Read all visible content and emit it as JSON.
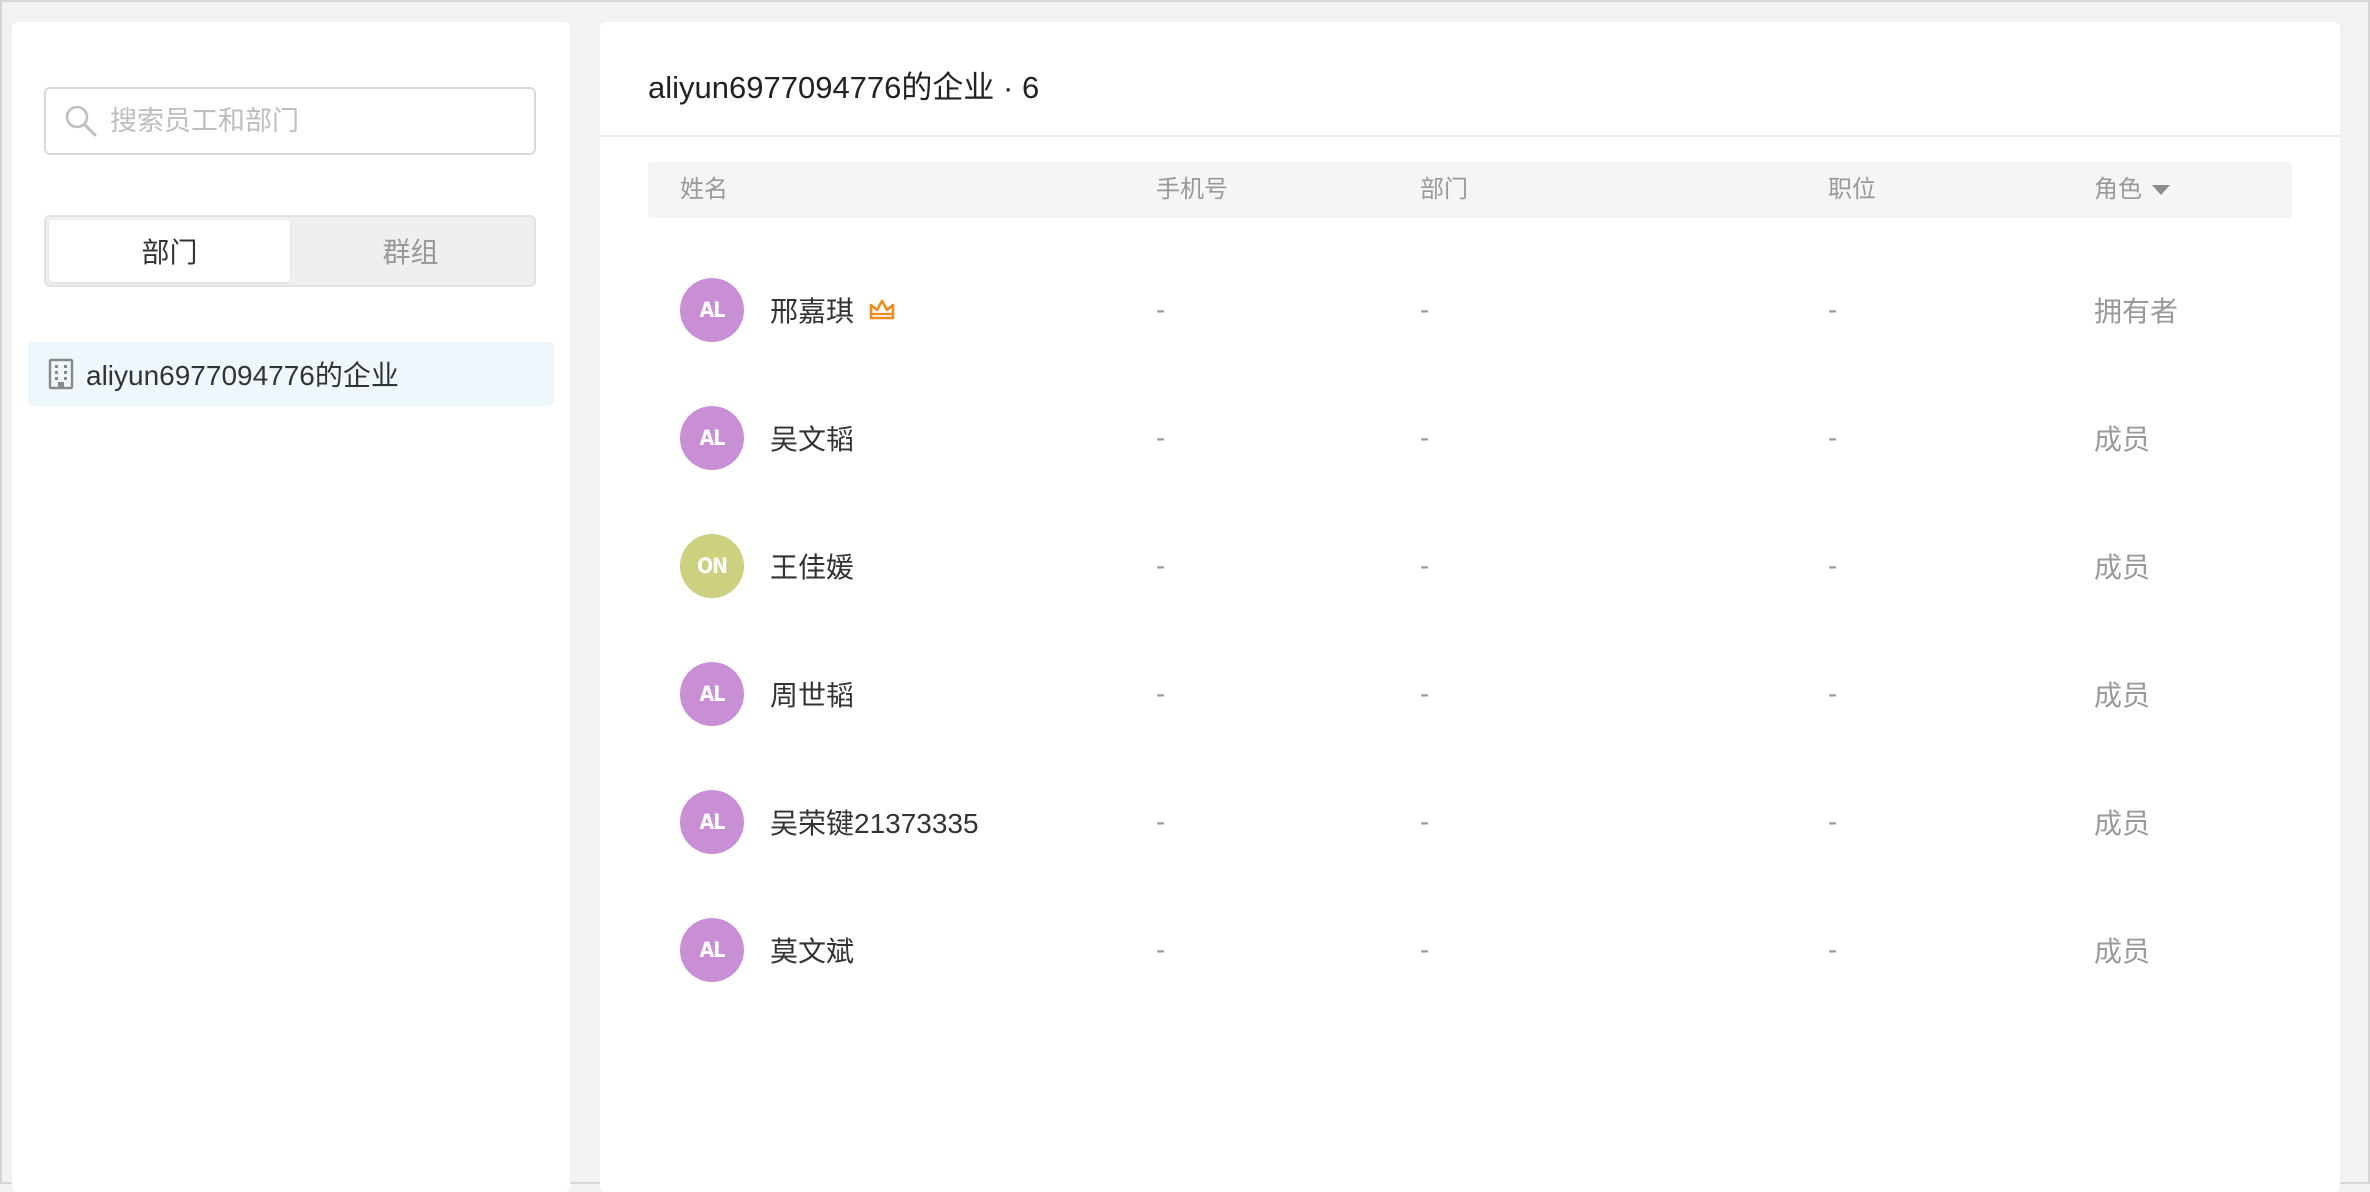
{
  "sidebar": {
    "search_placeholder": "搜索员工和部门",
    "tabs": [
      {
        "label": "部门",
        "active": true
      },
      {
        "label": "群组",
        "active": false
      }
    ],
    "tree": [
      {
        "label": "aliyun6977094776的企业"
      }
    ]
  },
  "main": {
    "title": "aliyun6977094776的企业 · 6",
    "columns": {
      "name": "姓名",
      "phone": "手机号",
      "dept": "部门",
      "position": "职位",
      "role": "角色"
    },
    "rows": [
      {
        "initials": "AL",
        "avatar_color": "#c98fd4",
        "name": "邢嘉琪",
        "owner_crown": true,
        "phone": "-",
        "dept": "-",
        "position": "-",
        "role": "拥有者"
      },
      {
        "initials": "AL",
        "avatar_color": "#c98fd4",
        "name": "吴文韬",
        "owner_crown": false,
        "phone": "-",
        "dept": "-",
        "position": "-",
        "role": "成员"
      },
      {
        "initials": "ON",
        "avatar_color": "#cdd07e",
        "name": "王佳媛",
        "owner_crown": false,
        "phone": "-",
        "dept": "-",
        "position": "-",
        "role": "成员"
      },
      {
        "initials": "AL",
        "avatar_color": "#c98fd4",
        "name": "周世韬",
        "owner_crown": false,
        "phone": "-",
        "dept": "-",
        "position": "-",
        "role": "成员"
      },
      {
        "initials": "AL",
        "avatar_color": "#c98fd4",
        "name": "吴荣键21373335",
        "owner_crown": false,
        "phone": "-",
        "dept": "-",
        "position": "-",
        "role": "成员"
      },
      {
        "initials": "AL",
        "avatar_color": "#c98fd4",
        "name": "莫文斌",
        "owner_crown": false,
        "phone": "-",
        "dept": "-",
        "position": "-",
        "role": "成员"
      }
    ]
  },
  "colors": {
    "crown": "#f08c1e",
    "selected_bg": "#eef8fc"
  },
  "icons": {
    "search": "search-icon",
    "building": "building-icon",
    "crown": "crown-icon",
    "caret": "caret-down-icon"
  }
}
